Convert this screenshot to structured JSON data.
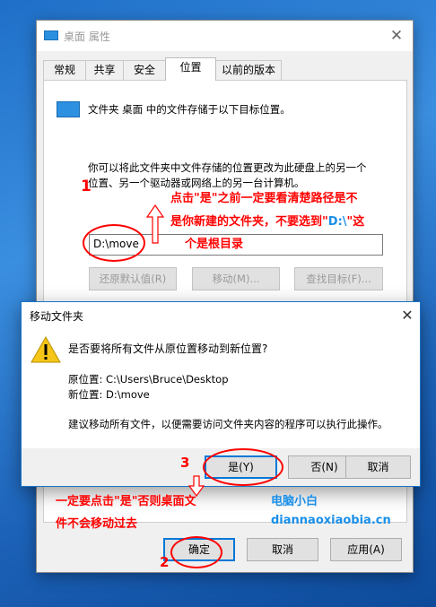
{
  "props_dialog": {
    "title": "桌面 属性",
    "close_glyph": "✕",
    "tabs": [
      "常规",
      "共享",
      "安全",
      "位置",
      "以前的版本"
    ],
    "active_tab": "位置",
    "folder_caption": "文件夹 桌面 中的文件存储于以下目标位置。",
    "description_line1": "你可以将此文件夹中文件存储的位置更改为此硬盘上的另一个",
    "description_line2": "位置、另一个驱动器或网络上的另一台计算机。",
    "path_value": "D:\\move",
    "restore_label": "还原默认值(R)",
    "move_label": "移动(M)...",
    "find_label": "查找目标(F)...",
    "ok_label": "确定",
    "cancel_label": "取消",
    "apply_label": "应用(A)"
  },
  "move_dialog": {
    "title": "移动文件夹",
    "close_glyph": "✕",
    "question": "是否要将所有文件从原位置移动到新位置?",
    "old_location": "原位置: C:\\Users\\Bruce\\Desktop",
    "new_location": "新位置: D:\\move",
    "advice": "建议移动所有文件，以便需要访问文件夹内容的程序可以执行此操作。",
    "yes_label": "是(Y)",
    "no_label": "否(N)",
    "cancel_label": "取消"
  },
  "annotations": {
    "step1": "1",
    "step2": "2",
    "step3": "3",
    "note_top_line1": "点击\"是\"之前一定要看清楚路径是不",
    "note_top_line2_a": "是你新建的文件夹，不要选到\"",
    "note_top_line2_b": "D:\\",
    "note_top_line2_c": "\"这",
    "note_top_line3": "个是根目录",
    "note_bottom_line1": "一定要点击\"是\"否则桌面文",
    "note_bottom_line2": "件不会移动过去",
    "brand_name": "电脑小白",
    "brand_url": "diannaoxiaobia.cn",
    "red_color": "#ff0000",
    "blue_color": "#1a8fe8"
  }
}
